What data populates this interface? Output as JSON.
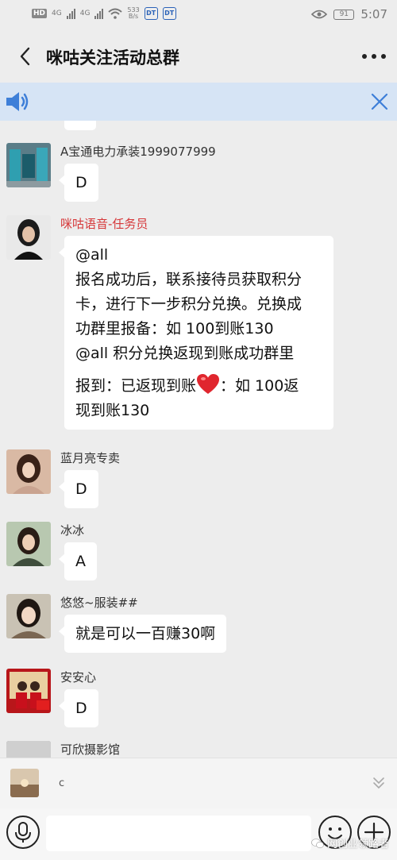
{
  "status_bar": {
    "hd_label": "HD",
    "sim1_label": "4G",
    "sim2_label": "4G",
    "net_speed": "533",
    "net_unit": "B/s",
    "app1": "DT",
    "app2": "DT",
    "battery": "91",
    "time": "5:07"
  },
  "header": {
    "title": "咪咕关注活动总群"
  },
  "messages": [
    {
      "sender": "A宝通电力承装1999077999",
      "text": "D"
    },
    {
      "sender": "咪咕语音-任务员",
      "lines": [
        "@all",
        "报名成功后，联系接待员获取积分",
        "卡，进行下一步积分兑换。兑换成",
        "功群里报备：如 100到账130",
        "@all 积分兑换返现到账成功群里"
      ],
      "line_after_1": "报到：已返现到账",
      "line_after_2": "：如 100返",
      "line_after_3": "现到账130"
    },
    {
      "sender": "蓝月亮专卖",
      "text": "D"
    },
    {
      "sender": "冰冰",
      "text": "A"
    },
    {
      "sender": "悠悠~服装##",
      "text": "就是可以一百赚30啊"
    },
    {
      "sender": "安安心",
      "text": "D"
    },
    {
      "sender": "可欣摄影馆"
    }
  ],
  "quote_bar": {
    "text": "c"
  },
  "input_bar": {
    "value": ""
  },
  "watermark": "网创业领路者",
  "colors": {
    "background": "#ededed",
    "notice_bar": "#d6e4f5",
    "accent_blue": "#3e7fd8",
    "sender_red": "#d6383a"
  }
}
